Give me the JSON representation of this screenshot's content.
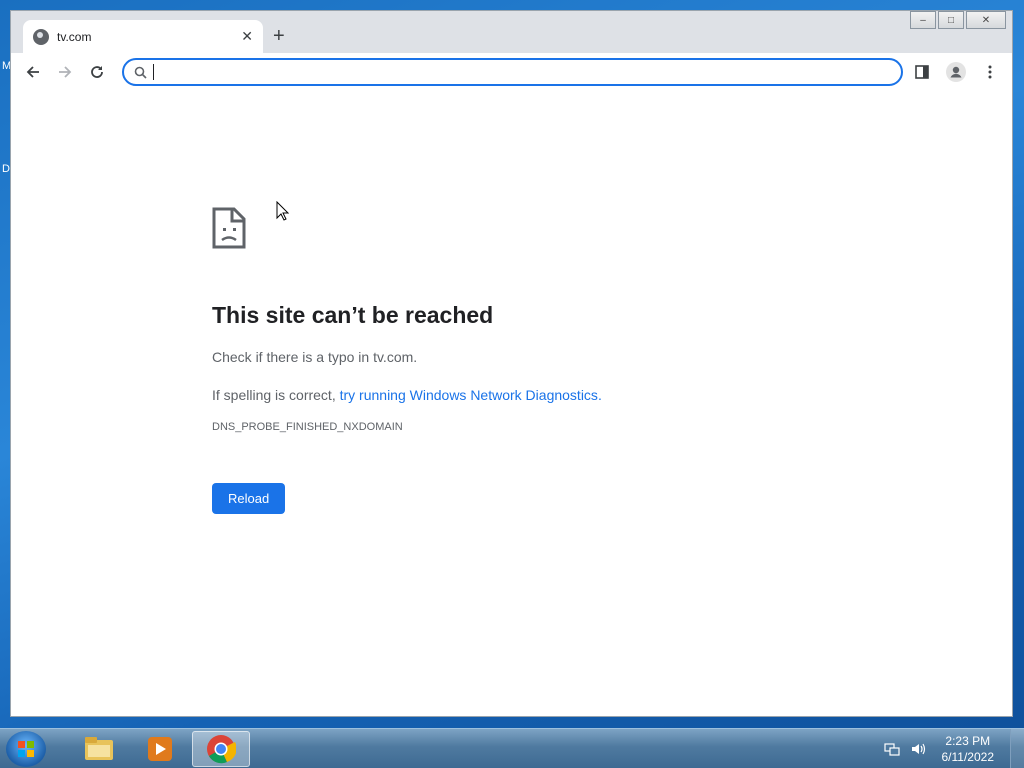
{
  "desktop": {
    "icon_letter_1": "M",
    "icon_letter_2": "D"
  },
  "window": {
    "controls": {
      "minimize": "–",
      "maximize": "□",
      "close": "✕"
    }
  },
  "tab": {
    "title": "tv.com",
    "close": "✕"
  },
  "newtab": "+",
  "omnibox": {
    "value": "",
    "placeholder": ""
  },
  "error": {
    "title": "This site can’t be reached",
    "line1": "Check if there is a typo in tv.com.",
    "line2_prefix": "If spelling is correct, ",
    "line2_link": "try running Windows Network Diagnostics",
    "line2_suffix": ".",
    "code": "DNS_PROBE_FINISHED_NXDOMAIN",
    "reload_label": "Reload"
  },
  "taskbar": {
    "items": [
      "file-explorer",
      "media-player",
      "chrome"
    ],
    "active": "chrome",
    "time": "2:23 PM",
    "date": "6/11/2022"
  },
  "colors": {
    "accent": "#1a73e8",
    "taskbar": "#4f7aa0",
    "desktop": "#1a6fc0"
  }
}
